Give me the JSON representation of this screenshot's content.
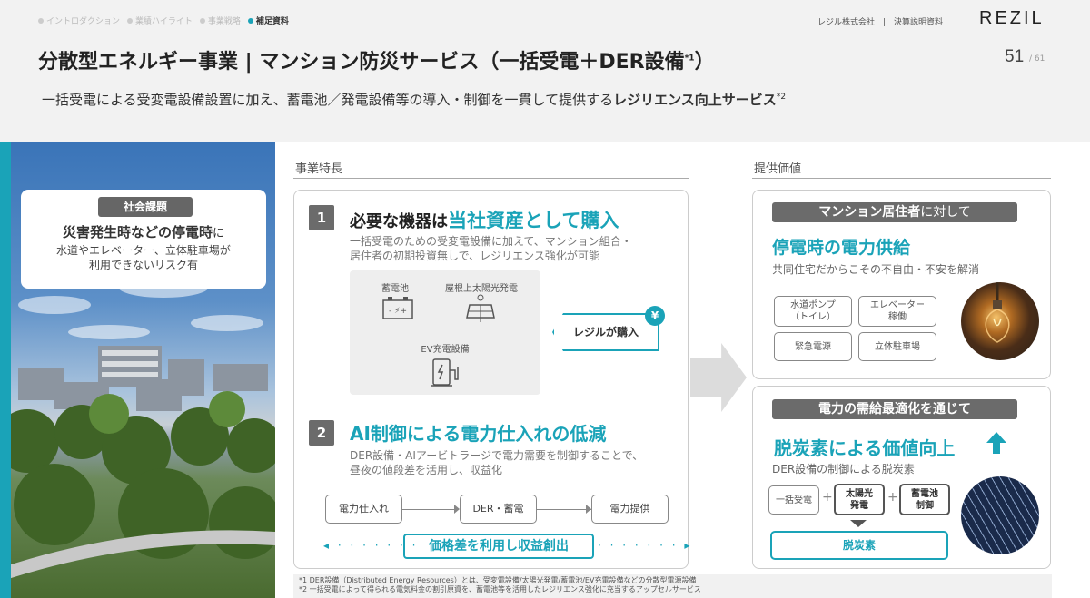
{
  "breadcrumbs": [
    {
      "label": "イントロダクション",
      "active": false
    },
    {
      "label": "業績ハイライト",
      "active": false
    },
    {
      "label": "事業戦略",
      "active": false
    },
    {
      "label": "補足資料",
      "active": true
    }
  ],
  "header": {
    "company": "レジル株式会社　|　決算説明資料",
    "logo": "REZIL",
    "title": "分散型エネルギー事業 | マンション防災サービス（一括受電＋DER設備",
    "title_sup": "*1",
    "title_end": "）",
    "page_no": "51",
    "page_total": "/ 61"
  },
  "subtitle": {
    "text": "一括受電による受変電設備設置に加え、蓄電池／発電設備等の導入・制御を一貫して提供する",
    "bold": "レジリエンス向上サービス",
    "sup": "*2"
  },
  "issue": {
    "tag": "社会課題",
    "main": "災害発生時などの停電時",
    "main_suffix": "に",
    "sub1": "水道やエレベーター、立体駐車場が",
    "sub2": "利用できないリスク有"
  },
  "features": {
    "section_label": "事業特長",
    "f1": {
      "num": "1",
      "head_pre": "必要な機器は",
      "head_big": "当社資産として購入",
      "desc1": "一括受電のための受変電設備に加えて、マンション組合・",
      "desc2": "居住者の初期投資無しで、レジリエンス強化が可能",
      "equip": [
        {
          "label": "蓄電池",
          "icon": "battery-icon"
        },
        {
          "label": "屋根上太陽光発電",
          "icon": "solar-panel-icon"
        },
        {
          "label": "EV充電設備",
          "icon": "ev-charger-icon"
        }
      ],
      "buy_tag": "レジルが購入",
      "yen": "¥"
    },
    "f2": {
      "num": "2",
      "head": "AI制御による電力仕入れの低減",
      "desc1": "DER設備・AIアービトラージで電力需要を制御することで、",
      "desc2": "昼夜の値段差を活用し、収益化",
      "flow": [
        "電力仕入れ",
        "DER・蓄電",
        "電力提供"
      ],
      "profit": "価格差を利用し収益創出",
      "dots": "◂ · · · · · · ·",
      "dots_right": "· · · · · · · ▸"
    }
  },
  "value": {
    "section_label": "提供価値",
    "v1": {
      "tag_bold": "マンション居住者",
      "tag_rest": "に対して",
      "head": "停電時の電力供給",
      "desc": "共同住宅だからこその不自由・不安を解消",
      "chips": [
        "水道ポンプ\n（トイレ）",
        "エレベーター\n稼働",
        "緊急電源",
        "立体駐車場"
      ]
    },
    "v2": {
      "tag": "電力の需給最適化を通じて",
      "head": "脱炭素による価値向上",
      "desc": "DER設備の制御による脱炭素",
      "chips": [
        "一括受電",
        "太陽光\n発電",
        "蓄電池\n制御"
      ],
      "plus": "+",
      "result": "脱炭素"
    }
  },
  "footnotes": {
    "n1": "*1 DER設備（Distributed Energy Resources）とは、受変電設備/太陽光発電/蓄電池/EV充電設備などの分散型電源設備",
    "n2": "*2 一括受電によって得られる電気料金の割引原資を、蓄電池等を活用したレジリエンス強化に充当するアップセルサービス"
  },
  "colors": {
    "accent": "#1aa3b8",
    "tag_gray": "#6b6b6b"
  }
}
